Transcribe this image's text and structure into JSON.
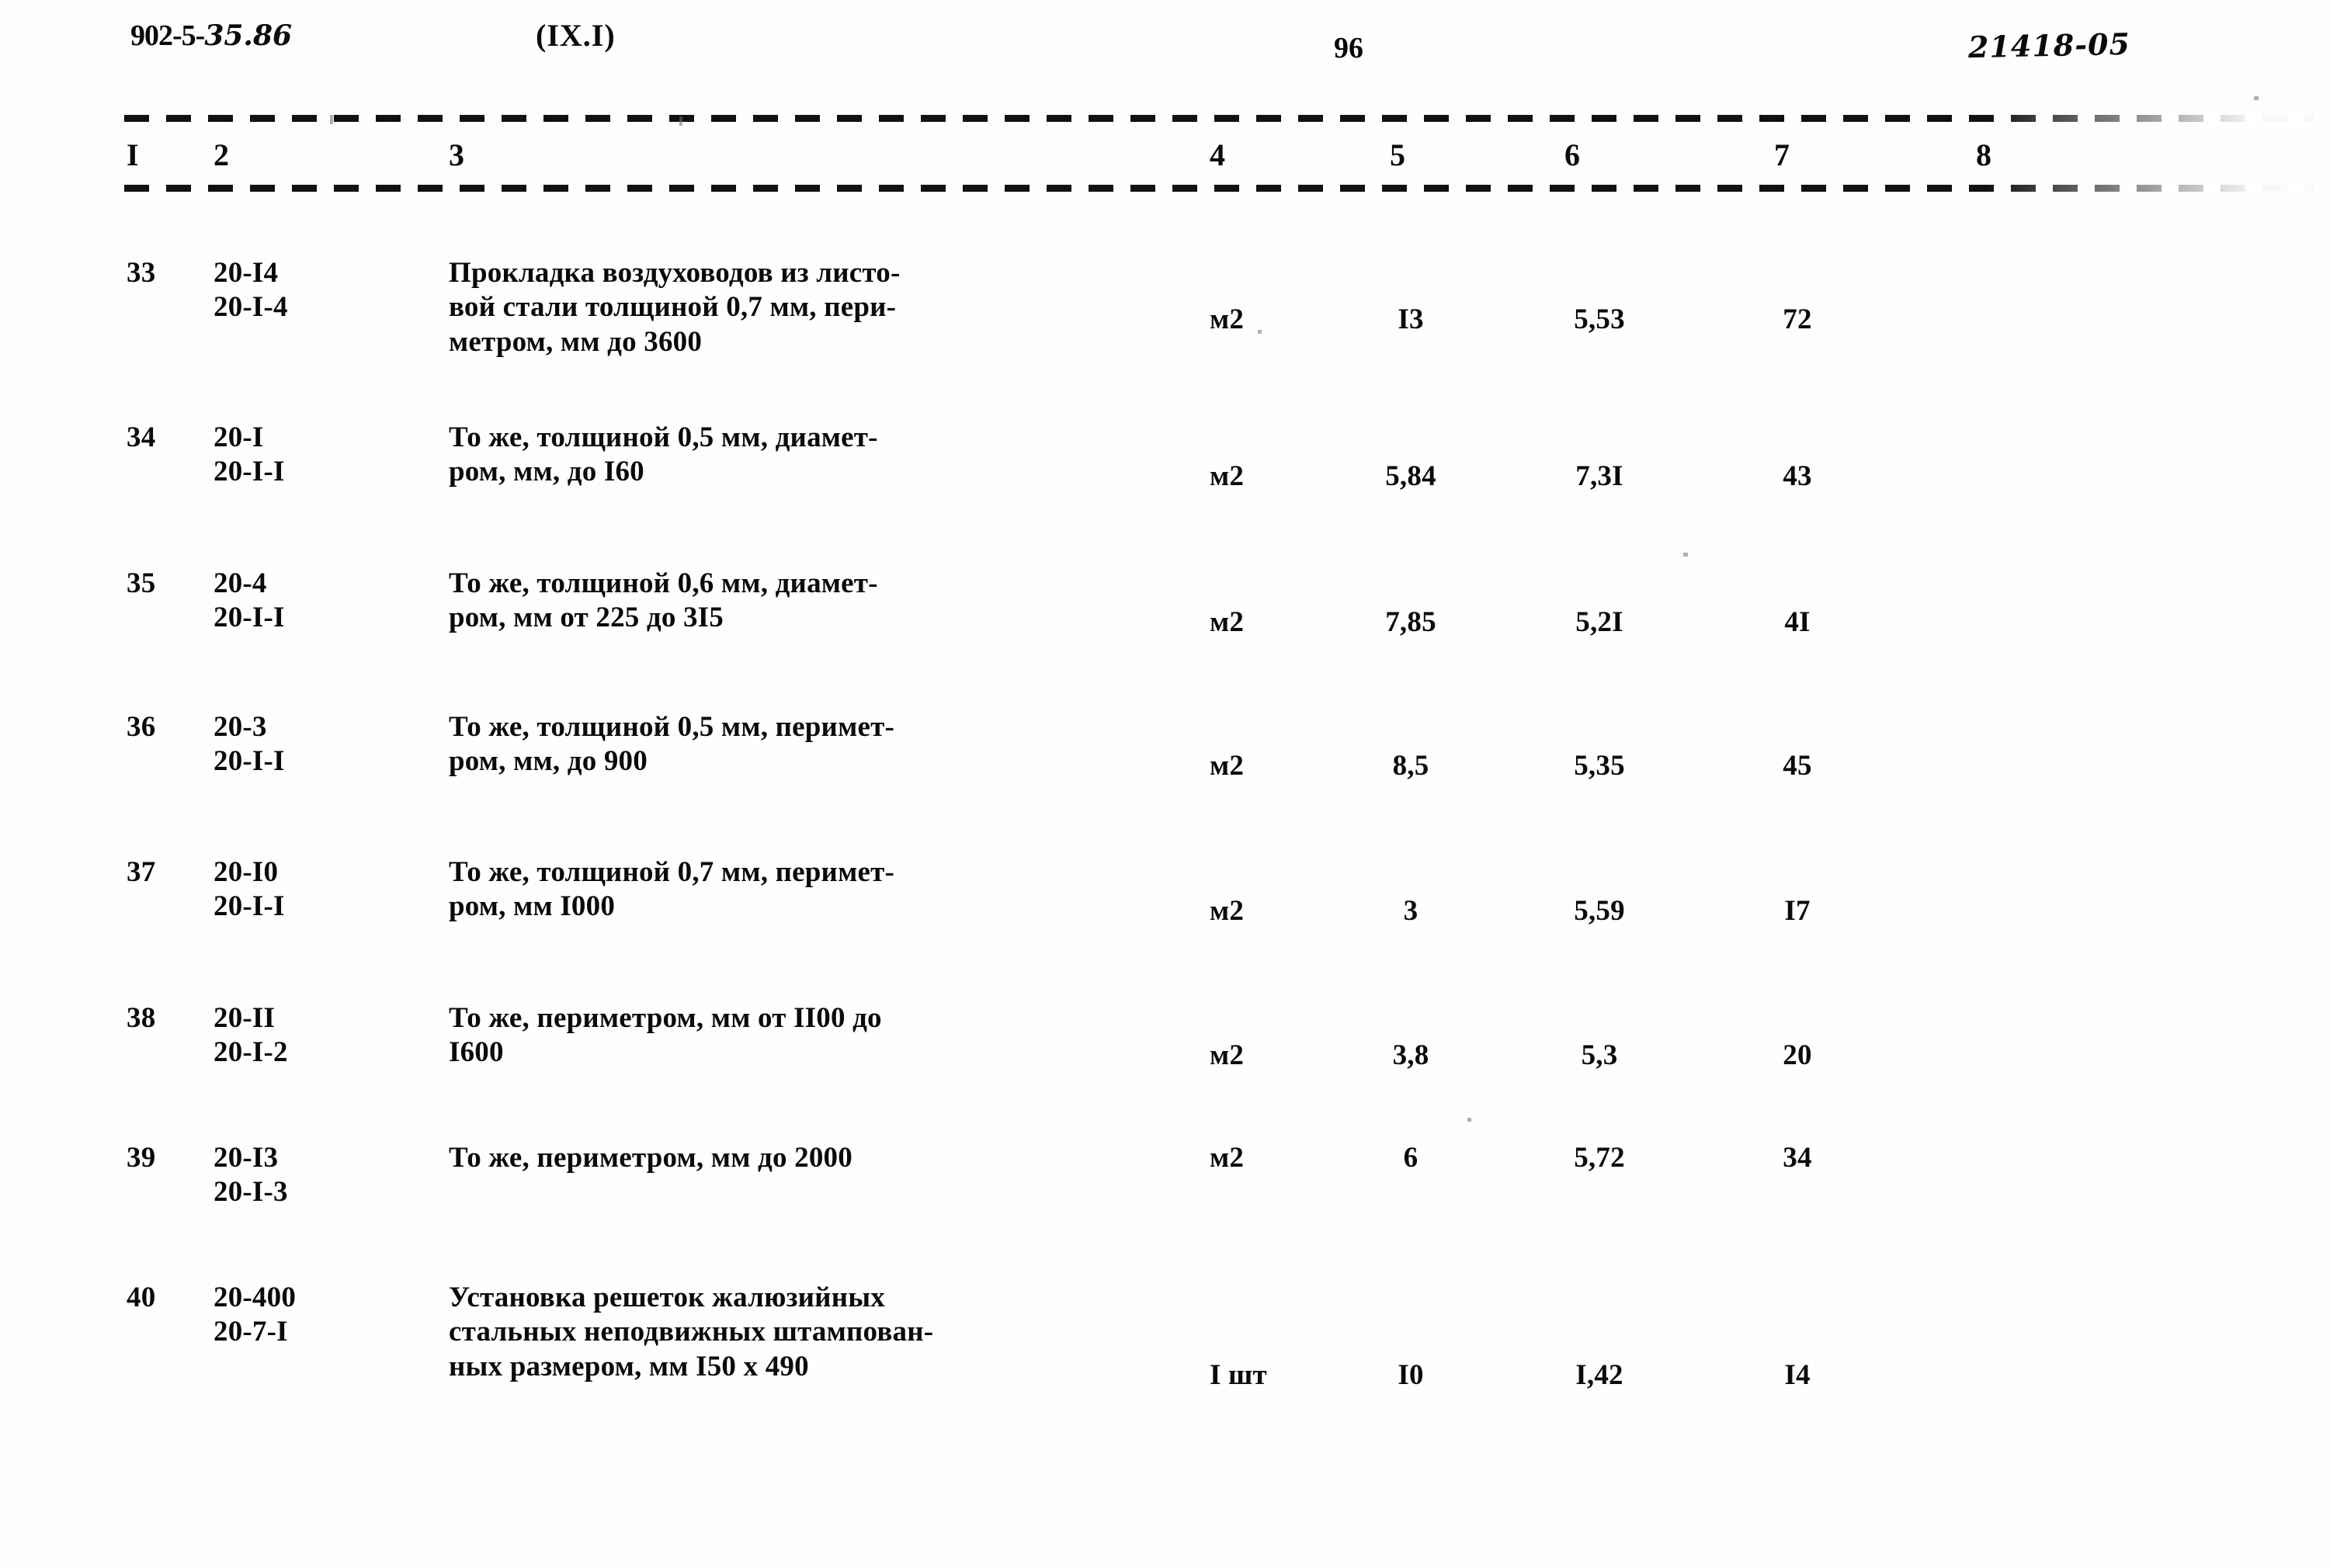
{
  "header": {
    "doc_code_prefix": "902-5-",
    "doc_code_suffix": "35.86",
    "section_ref": "(IX.I)",
    "page_number": "96",
    "archive_number": "21418-05"
  },
  "table": {
    "column_numbers": [
      "I",
      "2",
      "3",
      "4",
      "5",
      "6",
      "7",
      "8"
    ],
    "rows": [
      {
        "no": "33",
        "code_top": "20-I4",
        "code_bottom": "20-I-4",
        "description_lines": [
          "Прокладка воздуховодов из листо-",
          "вой стали толщиной 0,7 мм, пери-",
          "метром, мм до 3600"
        ],
        "unit": "м2",
        "col5": "I3",
        "col6": "5,53",
        "col7": "72",
        "col8": ""
      },
      {
        "no": "34",
        "code_top": "20-I",
        "code_bottom": "20-I-I",
        "description_lines": [
          "То же, толщиной 0,5 мм, диамет-",
          "ром, мм, до I60"
        ],
        "unit": "м2",
        "col5": "5,84",
        "col6": "7,3I",
        "col7": "43",
        "col8": ""
      },
      {
        "no": "35",
        "code_top": "20-4",
        "code_bottom": "20-I-I",
        "description_lines": [
          "То же, толщиной 0,6 мм, диамет-",
          "ром, мм от 225 до 3I5"
        ],
        "unit": "м2",
        "col5": "7,85",
        "col6": "5,2I",
        "col7": "4I",
        "col8": ""
      },
      {
        "no": "36",
        "code_top": "20-3",
        "code_bottom": "20-I-I",
        "description_lines": [
          "То же, толщиной 0,5 мм, перимет-",
          "ром, мм, до 900"
        ],
        "unit": "м2",
        "col5": "8,5",
        "col6": "5,35",
        "col7": "45",
        "col8": ""
      },
      {
        "no": "37",
        "code_top": "20-I0",
        "code_bottom": "20-I-I",
        "description_lines": [
          "То же, толщиной 0,7 мм, перимет-",
          "ром, мм I000"
        ],
        "unit": "м2",
        "col5": "3",
        "col6": "5,59",
        "col7": "I7",
        "col8": ""
      },
      {
        "no": "38",
        "code_top": "20-II",
        "code_bottom": "20-I-2",
        "description_lines": [
          "То же, периметром, мм от II00 до",
          "I600"
        ],
        "unit": "м2",
        "col5": "3,8",
        "col6": "5,3",
        "col7": "20",
        "col8": ""
      },
      {
        "no": "39",
        "code_top": "20-I3",
        "code_bottom": "20-I-3",
        "description_lines": [
          "То же, периметром, мм до 2000"
        ],
        "unit": "м2",
        "col5": "6",
        "col6": "5,72",
        "col7": "34",
        "col8": ""
      },
      {
        "no": "40",
        "code_top": "20-400",
        "code_bottom": "20-7-I",
        "description_lines": [
          "Установка решеток жалюзийных",
          "стальных неподвижных штампован-",
          "ных размером, мм I50 х 490"
        ],
        "unit": "I шт",
        "col5": "I0",
        "col6": "I,42",
        "col7": "I4",
        "col8": ""
      }
    ]
  }
}
